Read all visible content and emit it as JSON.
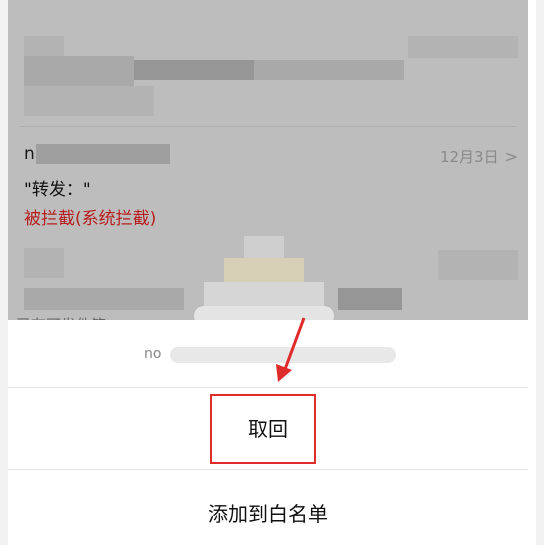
{
  "email_row": {
    "sender_prefix": "n",
    "date": "12月3日",
    "subject": "\"转发：\"",
    "status": "被拦截(系统拦截)"
  },
  "next_row_preview": "已有可发件箱",
  "sheet": {
    "email_prefix": "no",
    "actions": {
      "recall": "取回",
      "add_whitelist": "添加到白名单"
    }
  },
  "colors": {
    "blocked_text": "#b81d1d",
    "highlight_box": "#e02b2b",
    "arrow": "#e02b2b"
  },
  "icons": {
    "chevron": "chevron-right-icon"
  }
}
